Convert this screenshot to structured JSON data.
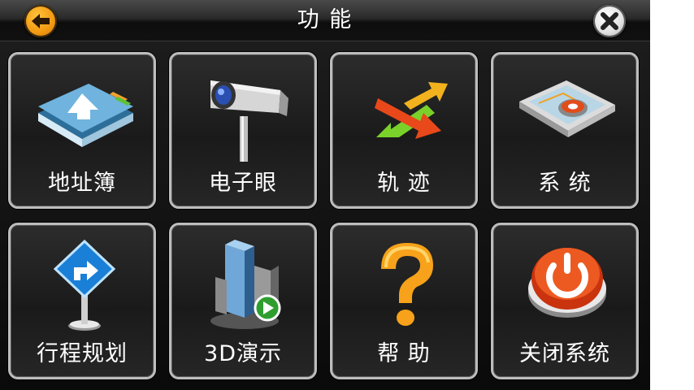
{
  "header": {
    "title": "功 能",
    "back_icon": "back-arrow-icon",
    "close_icon": "close-icon"
  },
  "colors": {
    "back_button": "#f39a12",
    "close_button": "#e2e2e2",
    "tile_border": "#bdbdbd",
    "background": "#111111"
  },
  "tiles": [
    {
      "label": "地址簿",
      "icon": "address-book-icon"
    },
    {
      "label": "电子眼",
      "icon": "camera-icon"
    },
    {
      "label": "轨 迹",
      "icon": "track-arrows-icon"
    },
    {
      "label": "系 统",
      "icon": "system-settings-icon"
    },
    {
      "label": "行程规划",
      "icon": "route-sign-icon"
    },
    {
      "label": "3D演示",
      "icon": "3d-demo-icon"
    },
    {
      "label": "帮 助",
      "icon": "help-icon"
    },
    {
      "label": "关闭系统",
      "icon": "power-icon"
    }
  ]
}
